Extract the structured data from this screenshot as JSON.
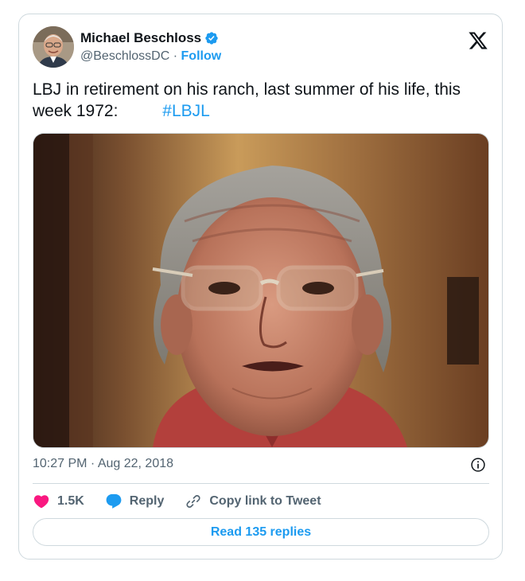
{
  "tweet": {
    "author": {
      "name": "Michael Beschloss",
      "handle": "@BeschlossDC",
      "separator": "·",
      "follow_label": "Follow",
      "verified": true
    },
    "text": "LBJ in retirement on his ranch, last summer of his life, this week 1972:",
    "hashtag": "#LBJL",
    "timestamp": "10:27 PM · Aug 22, 2018",
    "actions": {
      "likes": "1.5K",
      "reply_label": "Reply",
      "copy_label": "Copy link to Tweet"
    },
    "read_replies_label": "Read 135 replies"
  },
  "colors": {
    "accent": "#1d9bf0",
    "like": "#f91880",
    "secondary_text": "#536471",
    "border": "#cfd9de"
  },
  "icons": {
    "platform": "x-logo-icon",
    "verified": "verified-badge-icon",
    "info": "info-icon",
    "like": "heart-icon",
    "reply": "speech-bubble-icon",
    "copy": "link-icon"
  }
}
